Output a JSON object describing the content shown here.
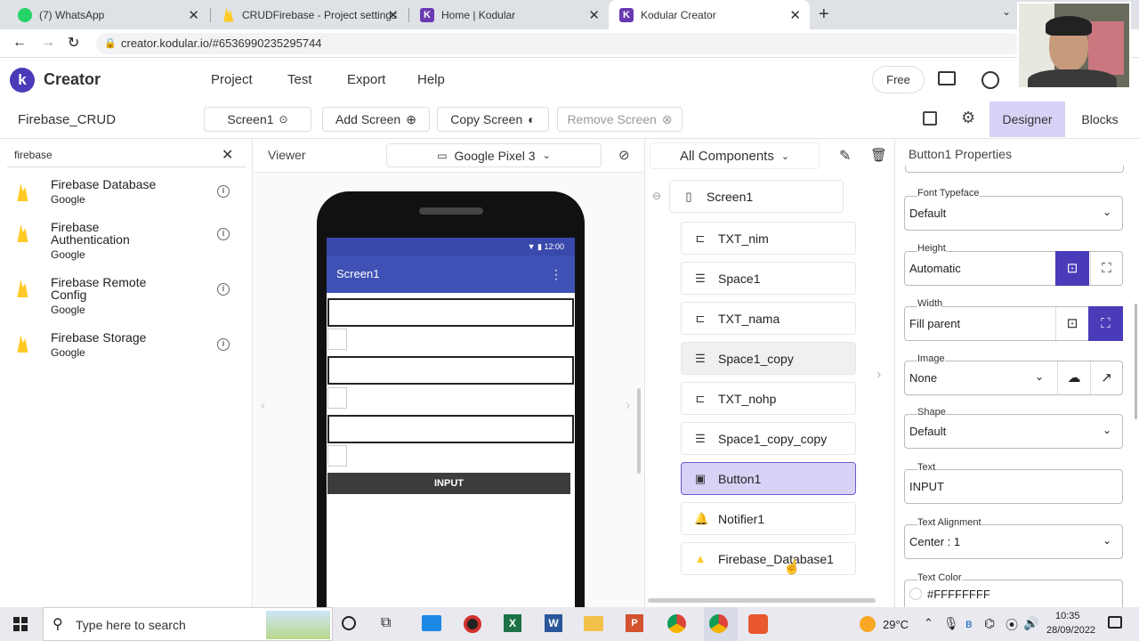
{
  "browser": {
    "tabs": [
      {
        "label": "(7) WhatsApp",
        "color": "#25d366"
      },
      {
        "label": "CRUDFirebase - Project settings",
        "color": "#ffca28"
      },
      {
        "label": "Home | Kodular",
        "color": "#6a3ab2"
      },
      {
        "label": "Kodular Creator",
        "color": "#6a3ab2"
      }
    ],
    "url": "creator.kodular.io/#6536990235295744"
  },
  "header": {
    "brand": "Creator",
    "menu": [
      "Project",
      "Test",
      "Export",
      "Help"
    ],
    "plan": "Free"
  },
  "toolbar": {
    "project_name": "Firebase_CRUD",
    "screen": "Screen1",
    "add_screen": "Add Screen",
    "copy_screen": "Copy Screen",
    "remove_screen": "Remove Screen",
    "designer": "Designer",
    "blocks": "Blocks"
  },
  "palette": {
    "search_value": "firebase",
    "items": [
      {
        "name": "Firebase Database",
        "vendor": "Google"
      },
      {
        "name": "Firebase Authentication",
        "vendor": "Google"
      },
      {
        "name": "Firebase Remote Config",
        "vendor": "Google"
      },
      {
        "name": "Firebase Storage",
        "vendor": "Google"
      }
    ]
  },
  "viewer": {
    "title": "Viewer",
    "device": "Google Pixel 3",
    "phone_time": "12:00",
    "screen_title": "Screen1",
    "button_text": "INPUT"
  },
  "components": {
    "filter": "All Components",
    "root": "Screen1",
    "items": [
      "TXT_nim",
      "Space1",
      "TXT_nama",
      "Space1_copy",
      "TXT_nohp",
      "Space1_copy_copy",
      "Button1",
      "Notifier1",
      "Firebase_Database1"
    ],
    "selected": "Button1"
  },
  "properties": {
    "title": "Button1 Properties",
    "font_typeface": {
      "label": "Font Typeface",
      "value": "Default"
    },
    "height": {
      "label": "Height",
      "value": "Automatic"
    },
    "width": {
      "label": "Width",
      "value": "Fill parent"
    },
    "image": {
      "label": "Image",
      "value": "None"
    },
    "shape": {
      "label": "Shape",
      "value": "Default"
    },
    "text": {
      "label": "Text",
      "value": "INPUT"
    },
    "text_alignment": {
      "label": "Text Alignment",
      "value": "Center : 1"
    },
    "text_color": {
      "label": "Text Color",
      "value": "#FFFFFFFF"
    }
  },
  "taskbar": {
    "search_placeholder": "Type here to search",
    "weather": "29°C",
    "time": "10:35",
    "date": "28/09/2022"
  },
  "colors": {
    "accent": "#5c4ec7",
    "selected_bg": "#d9d2f7",
    "phone_bar": "#3f51b5"
  }
}
